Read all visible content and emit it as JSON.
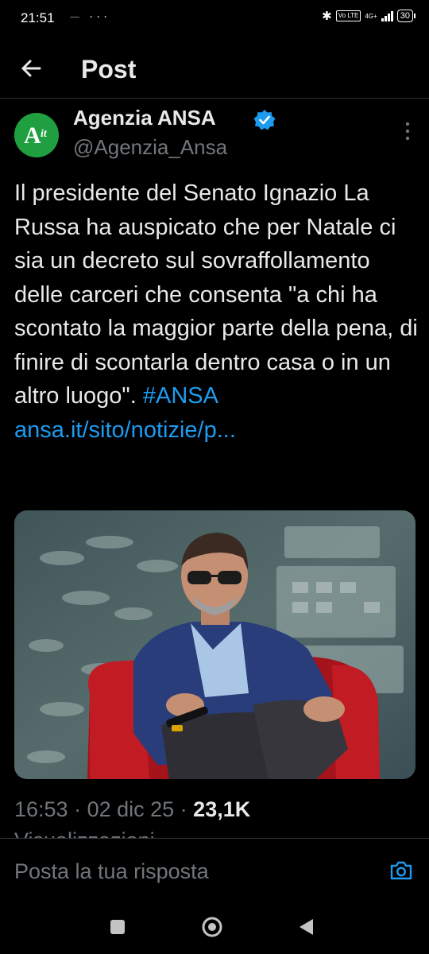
{
  "status_bar": {
    "time": "21:51",
    "left_icons": "⏤ ···",
    "network": "4G+",
    "volte": "Vo LTE",
    "battery": "30"
  },
  "header": {
    "title": "Post"
  },
  "author": {
    "name": "Agenzia ANSA",
    "handle": "@Agenzia_Ansa",
    "avatar_text": "A",
    "avatar_sub": "it",
    "verified": true
  },
  "tweet": {
    "text": "Il presidente del Senato Ignazio La Russa ha auspicato che per Natale ci sia un decreto sul sovraffollamento delle carceri che consenta \"a chi ha scontato la maggior parte della pena, di finire di scontarla dentro casa o in un altro luogo\".",
    "hashtag": "#ANSA",
    "link": "ansa.it/sito/notizie/p..."
  },
  "meta": {
    "time": "16:53",
    "date": "02 dic 25",
    "views": "23,1K",
    "views_label": "Visualizzazioni"
  },
  "reply": {
    "placeholder": "Posta la tua risposta"
  },
  "colors": {
    "accent": "#1d9bf0",
    "muted": "#71767b",
    "ansa_green": "#1f9f3f"
  },
  "icons": [
    "back-arrow-icon",
    "verified-icon",
    "more-icon",
    "camera-icon",
    "bluetooth-icon"
  ]
}
